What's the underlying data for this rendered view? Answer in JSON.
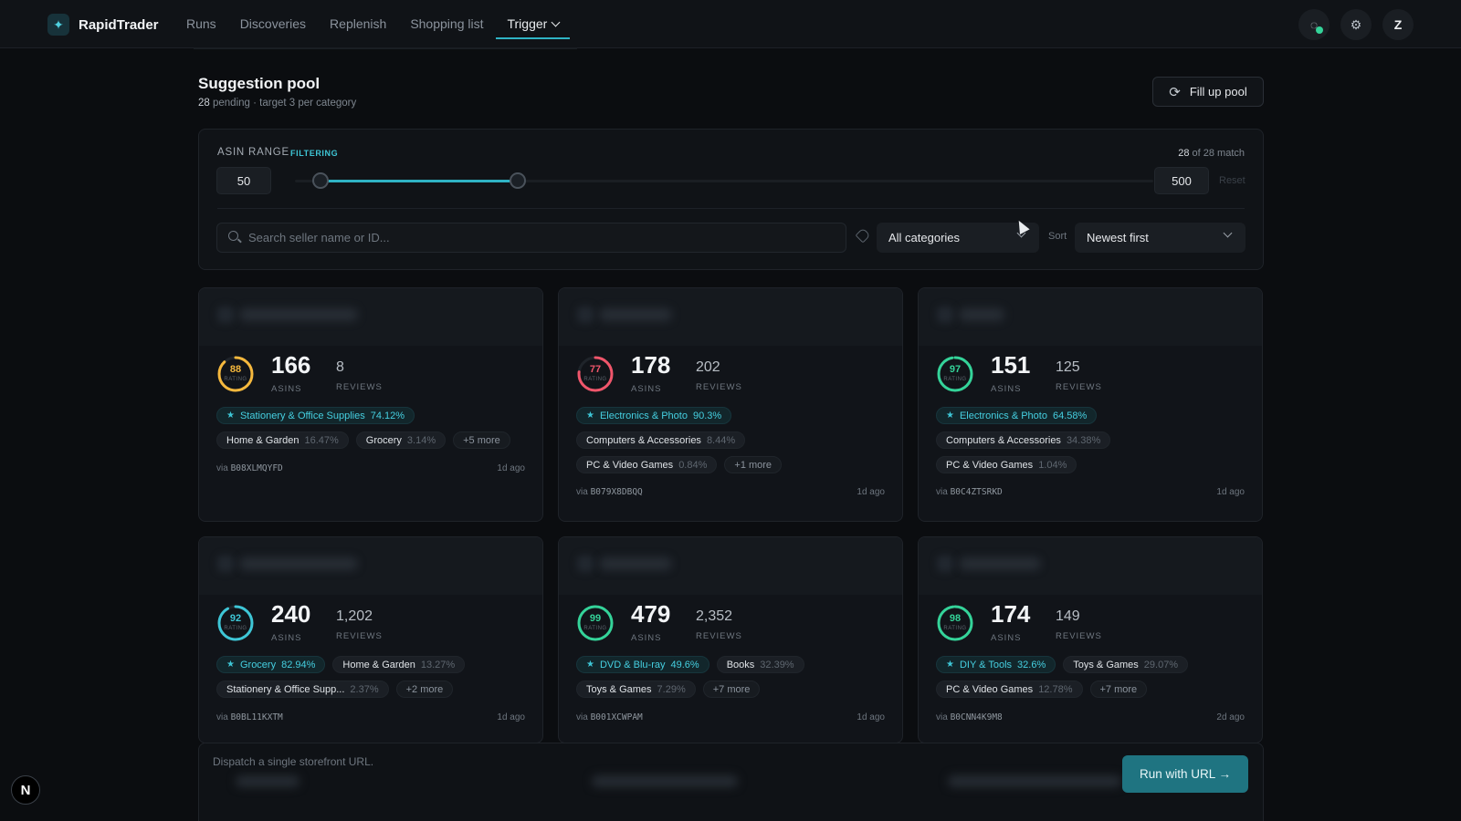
{
  "app": {
    "name": "RapidTrader",
    "logo_icon": "sparkle-icon"
  },
  "nav": {
    "items": [
      {
        "label": "Runs"
      },
      {
        "label": "Discoveries"
      },
      {
        "label": "Replenish"
      },
      {
        "label": "Shopping list"
      },
      {
        "label": "Trigger",
        "active": true,
        "dropdown": true
      }
    ]
  },
  "top_icons": [
    {
      "name": "status-check-icon",
      "status_color": "#34d399"
    },
    {
      "name": "gear-icon"
    },
    {
      "name": "avatar",
      "label": "Z"
    }
  ],
  "pool": {
    "title": "Suggestion pool",
    "pending_count": "28",
    "pending_text": "pending · target 3 per category",
    "fill_button": "Fill up pool"
  },
  "filters": {
    "range_label": "ASIN RANGE",
    "range_status": "FILTERING",
    "match_count": "28",
    "match_text": "of 28 match",
    "min": "50",
    "max": "500",
    "range_selected_fraction": [
      0.03,
      0.26
    ],
    "reset_label": "Reset",
    "search_placeholder": "Search seller name or ID...",
    "category": "All categories",
    "sort_label": "Sort",
    "sort": "Newest first"
  },
  "cards": [
    {
      "rating": "88",
      "rating_color": "#f5b83d",
      "rating_label": "RATING",
      "asins": "166",
      "asins_label": "ASINS",
      "reviews": "8",
      "reviews_label": "REVIEWS",
      "top_category": {
        "label": "Stationery & Office Supplies",
        "pct": "74.12%"
      },
      "categories": [
        {
          "label": "Home & Garden",
          "pct": "16.47%"
        },
        {
          "label": "Grocery",
          "pct": "3.14%"
        }
      ],
      "more": "+5 more",
      "via_label": "via",
      "via_id": "B08XLMQYFD",
      "ago": "1d ago"
    },
    {
      "rating": "77",
      "rating_color": "#f0566b",
      "rating_label": "RATING",
      "asins": "178",
      "asins_label": "ASINS",
      "reviews": "202",
      "reviews_label": "REVIEWS",
      "top_category": {
        "label": "Electronics & Photo",
        "pct": "90.3%"
      },
      "categories": [
        {
          "label": "Computers & Accessories",
          "pct": "8.44%"
        },
        {
          "label": "PC & Video Games",
          "pct": "0.84%"
        }
      ],
      "more": "+1 more",
      "via_label": "via",
      "via_id": "B079X8DBQQ",
      "ago": "1d ago"
    },
    {
      "rating": "97",
      "rating_color": "#34d399",
      "rating_label": "RATING",
      "asins": "151",
      "asins_label": "ASINS",
      "reviews": "125",
      "reviews_label": "REVIEWS",
      "top_category": {
        "label": "Electronics & Photo",
        "pct": "64.58%"
      },
      "categories": [
        {
          "label": "Computers & Accessories",
          "pct": "34.38%"
        },
        {
          "label": "PC & Video Games",
          "pct": "1.04%"
        }
      ],
      "more": "",
      "via_label": "via",
      "via_id": "B0C4ZTSRKD",
      "ago": "1d ago"
    },
    {
      "rating": "92",
      "rating_color": "#3ec6d6",
      "rating_label": "RATING",
      "asins": "240",
      "asins_label": "ASINS",
      "reviews": "1,202",
      "reviews_label": "REVIEWS",
      "top_category": {
        "label": "Grocery",
        "pct": "82.94%"
      },
      "categories": [
        {
          "label": "Home & Garden",
          "pct": "13.27%"
        },
        {
          "label": "Stationery & Office Supp...",
          "pct": "2.37%"
        }
      ],
      "more": "+2 more",
      "via_label": "via",
      "via_id": "B0BL11KXTM",
      "ago": "1d ago"
    },
    {
      "rating": "99",
      "rating_color": "#34d399",
      "rating_label": "RATING",
      "asins": "479",
      "asins_label": "ASINS",
      "reviews": "2,352",
      "reviews_label": "REVIEWS",
      "top_category": {
        "label": "DVD & Blu-ray",
        "pct": "49.6%"
      },
      "categories": [
        {
          "label": "Books",
          "pct": "32.39%"
        },
        {
          "label": "Toys & Games",
          "pct": "7.29%"
        }
      ],
      "more": "+7 more",
      "via_label": "via",
      "via_id": "B001XCWPAM",
      "ago": "1d ago"
    },
    {
      "rating": "98",
      "rating_color": "#34d399",
      "rating_label": "RATING",
      "asins": "174",
      "asins_label": "ASINS",
      "reviews": "149",
      "reviews_label": "REVIEWS",
      "top_category": {
        "label": "DIY & Tools",
        "pct": "32.6%"
      },
      "categories": [
        {
          "label": "Toys & Games",
          "pct": "29.07%"
        },
        {
          "label": "PC & Video Games",
          "pct": "12.78%"
        }
      ],
      "more": "+7 more",
      "via_label": "via",
      "via_id": "B0CNN4K9M8",
      "ago": "2d ago"
    }
  ],
  "dispatch": {
    "text": "Dispatch a single storefront URL.",
    "button": "Run with URL →"
  },
  "badge": {
    "label": "N"
  }
}
